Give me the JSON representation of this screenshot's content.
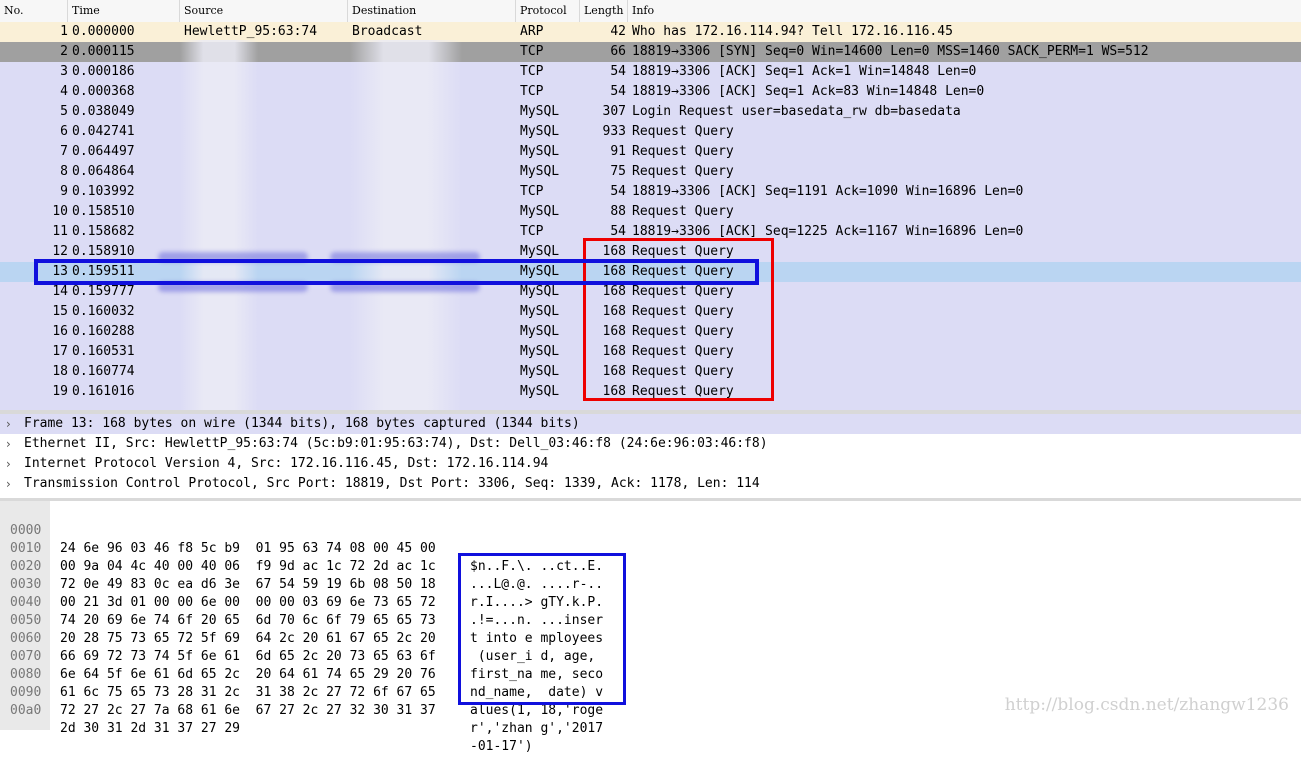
{
  "columns": {
    "no": "No.",
    "time": "Time",
    "source": "Source",
    "destination": "Destination",
    "protocol": "Protocol",
    "length": "Length",
    "info": "Info"
  },
  "packets": [
    {
      "no": "1",
      "time": "0.000000",
      "source": "HewlettP_95:63:74",
      "destination": "Broadcast",
      "protocol": "ARP",
      "length": "42",
      "info": "Who has 172.16.114.94? Tell 172.16.116.45"
    },
    {
      "no": "2",
      "time": "0.000115",
      "source": "",
      "destination": "",
      "protocol": "TCP",
      "length": "66",
      "info": "18819→3306 [SYN] Seq=0 Win=14600 Len=0 MSS=1460 SACK_PERM=1 WS=512"
    },
    {
      "no": "3",
      "time": "0.000186",
      "source": "",
      "destination": "",
      "protocol": "TCP",
      "length": "54",
      "info": "18819→3306 [ACK] Seq=1 Ack=1 Win=14848 Len=0"
    },
    {
      "no": "4",
      "time": "0.000368",
      "source": "",
      "destination": "",
      "protocol": "TCP",
      "length": "54",
      "info": "18819→3306 [ACK] Seq=1 Ack=83 Win=14848 Len=0"
    },
    {
      "no": "5",
      "time": "0.038049",
      "source": "",
      "destination": "",
      "protocol": "MySQL",
      "length": "307",
      "info": "Login Request user=basedata_rw db=basedata"
    },
    {
      "no": "6",
      "time": "0.042741",
      "source": "",
      "destination": "",
      "protocol": "MySQL",
      "length": "933",
      "info": "Request Query"
    },
    {
      "no": "7",
      "time": "0.064497",
      "source": "",
      "destination": "",
      "protocol": "MySQL",
      "length": "91",
      "info": "Request Query"
    },
    {
      "no": "8",
      "time": "0.064864",
      "source": "",
      "destination": "",
      "protocol": "MySQL",
      "length": "75",
      "info": "Request Query"
    },
    {
      "no": "9",
      "time": "0.103992",
      "source": "",
      "destination": "",
      "protocol": "TCP",
      "length": "54",
      "info": "18819→3306 [ACK] Seq=1191 Ack=1090 Win=16896 Len=0"
    },
    {
      "no": "10",
      "time": "0.158510",
      "source": "",
      "destination": "",
      "protocol": "MySQL",
      "length": "88",
      "info": "Request Query"
    },
    {
      "no": "11",
      "time": "0.158682",
      "source": "",
      "destination": "",
      "protocol": "TCP",
      "length": "54",
      "info": "18819→3306 [ACK] Seq=1225 Ack=1167 Win=16896 Len=0"
    },
    {
      "no": "12",
      "time": "0.158910",
      "source": "",
      "destination": "",
      "protocol": "MySQL",
      "length": "168",
      "info": "Request Query"
    },
    {
      "no": "13",
      "time": "0.159511",
      "source": "",
      "destination": "",
      "protocol": "MySQL",
      "length": "168",
      "info": "Request Query"
    },
    {
      "no": "14",
      "time": "0.159777",
      "source": "",
      "destination": "",
      "protocol": "MySQL",
      "length": "168",
      "info": "Request Query"
    },
    {
      "no": "15",
      "time": "0.160032",
      "source": "",
      "destination": "",
      "protocol": "MySQL",
      "length": "168",
      "info": "Request Query"
    },
    {
      "no": "16",
      "time": "0.160288",
      "source": "",
      "destination": "",
      "protocol": "MySQL",
      "length": "168",
      "info": "Request Query"
    },
    {
      "no": "17",
      "time": "0.160531",
      "source": "",
      "destination": "",
      "protocol": "MySQL",
      "length": "168",
      "info": "Request Query"
    },
    {
      "no": "18",
      "time": "0.160774",
      "source": "",
      "destination": "",
      "protocol": "MySQL",
      "length": "168",
      "info": "Request Query"
    },
    {
      "no": "19",
      "time": "0.161016",
      "source": "",
      "destination": "",
      "protocol": "MySQL",
      "length": "168",
      "info": "Request Query"
    }
  ],
  "details": [
    "Frame 13: 168 bytes on wire (1344 bits), 168 bytes captured (1344 bits)",
    "Ethernet II, Src: HewlettP_95:63:74 (5c:b9:01:95:63:74), Dst: Dell_03:46:f8 (24:6e:96:03:46:f8)",
    "Internet Protocol Version 4, Src: 172.16.116.45, Dst: 172.16.114.94",
    "Transmission Control Protocol, Src Port: 18819, Dst Port: 3306, Seq: 1339, Ack: 1178, Len: 114"
  ],
  "bytes": [
    {
      "offset": "0000",
      "hex": "24 6e 96 03 46 f8 5c b9  01 95 63 74 08 00 45 00",
      "ascii": "$n..F.\\. ..ct..E."
    },
    {
      "offset": "0010",
      "hex": "00 9a 04 4c 40 00 40 06  f9 9d ac 1c 72 2d ac 1c",
      "ascii": "...L@.@. ....r-.."
    },
    {
      "offset": "0020",
      "hex": "72 0e 49 83 0c ea d6 3e  67 54 59 19 6b 08 50 18",
      "ascii": "r.I....> gTY.k.P."
    },
    {
      "offset": "0030",
      "hex": "00 21 3d 01 00 00 6e 00  00 00 03 69 6e 73 65 72",
      "ascii": ".!=...n. ...inser"
    },
    {
      "offset": "0040",
      "hex": "74 20 69 6e 74 6f 20 65  6d 70 6c 6f 79 65 65 73",
      "ascii": "t into e mployees"
    },
    {
      "offset": "0050",
      "hex": "20 28 75 73 65 72 5f 69  64 2c 20 61 67 65 2c 20",
      "ascii": " (user_i d, age,"
    },
    {
      "offset": "0060",
      "hex": "66 69 72 73 74 5f 6e 61  6d 65 2c 20 73 65 63 6f",
      "ascii": "first_na me, seco"
    },
    {
      "offset": "0070",
      "hex": "6e 64 5f 6e 61 6d 65 2c  20 64 61 74 65 29 20 76",
      "ascii": "nd_name,  date) v"
    },
    {
      "offset": "0080",
      "hex": "61 6c 75 65 73 28 31 2c  31 38 2c 27 72 6f 67 65",
      "ascii": "alues(1, 18,'roge"
    },
    {
      "offset": "0090",
      "hex": "72 27 2c 27 7a 68 61 6e  67 27 2c 27 32 30 31 37",
      "ascii": "r','zhan g','2017"
    },
    {
      "offset": "00a0",
      "hex": "2d 30 31 2d 31 37 27 29",
      "ascii": "-01-17')"
    }
  ],
  "watermark": "http://blog.csdn.net/zhangw1236"
}
